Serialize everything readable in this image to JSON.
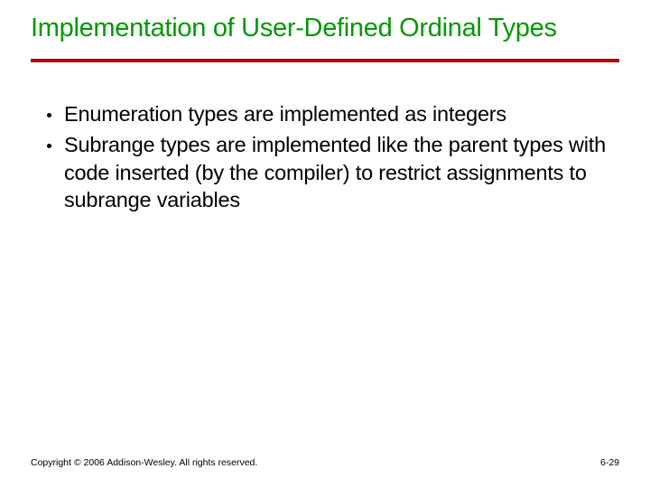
{
  "title": "Implementation of User-Defined Ordinal Types",
  "bullets": [
    "Enumeration types are implemented as integers",
    "Subrange types are implemented like the parent types with code inserted (by the compiler) to restrict assignments to subrange variables"
  ],
  "footer": {
    "copyright": "Copyright © 2006 Addison-Wesley. All rights reserved.",
    "page": "6-29"
  }
}
